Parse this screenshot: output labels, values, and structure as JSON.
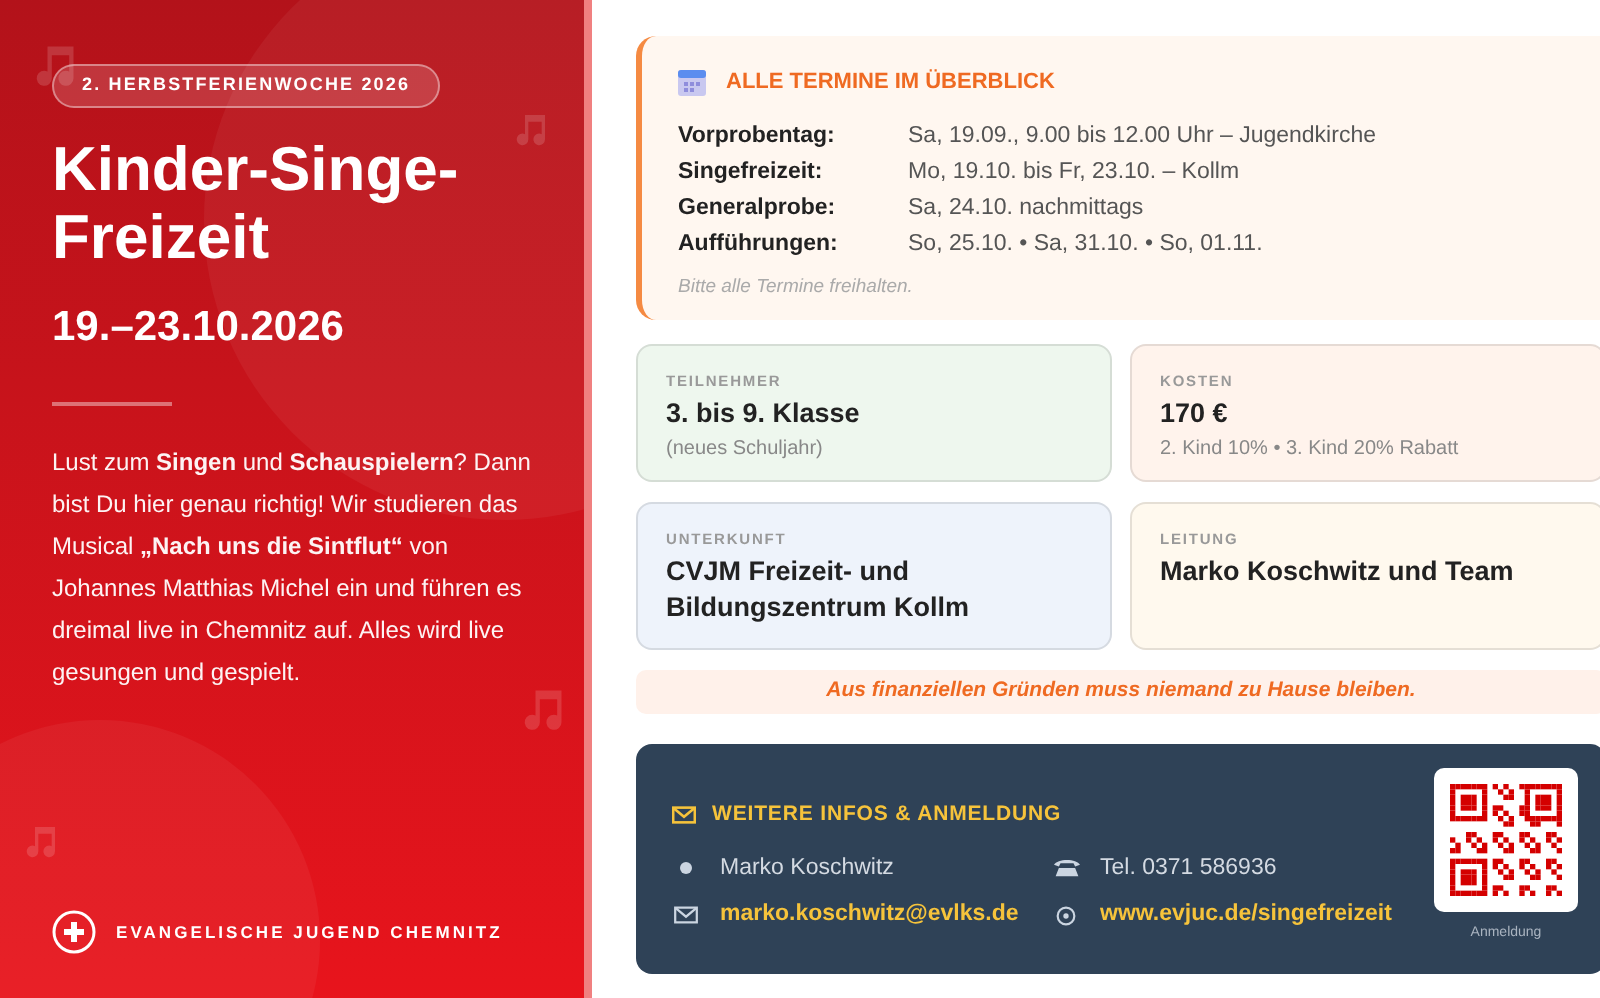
{
  "hero": {
    "badge": "2. HERBSTFERIENWOCHE 2026",
    "title": "Kinder-Singe-Freizeit",
    "date": "19.–23.10.2026",
    "intro": "Lust zum **Singen** und **Schauspielern**? Dann bist Du hier genau richtig! Wir studieren das Musical **„Nach uns die Sintflut“** von Johannes Matthias Michel ein und führen es dreimal live in Chemnitz auf. Alles wird live gesungen und gespielt.",
    "organization": "EVANGELISCHE JUGEND CHEMNITZ"
  },
  "schedule": {
    "title": "ALLE TERMINE IM ÜBERBLICK",
    "rows": [
      {
        "label": "Vorprobentag:",
        "value": "Sa, 19.09., 9.00 bis 12.00 Uhr – Jugendkirche"
      },
      {
        "label": "Singefreizeit:",
        "value": "Mo, 19.10. bis Fr, 23.10. – Kollm"
      },
      {
        "label": "Generalprobe:",
        "value": "Sa, 24.10. nachmittags"
      },
      {
        "label": "Aufführungen:",
        "value": "So, 25.10. • Sa, 31.10. • So, 01.11."
      }
    ],
    "note": "Bitte alle Termine freihalten."
  },
  "info_cards": [
    {
      "label": "TEILNEHMER",
      "value": "3. bis 9. Klasse",
      "detail": "(neues Schuljahr)",
      "color": "#eef7ee"
    },
    {
      "label": "KOSTEN",
      "value": "170 €",
      "detail": "2. Kind 10% • 3. Kind 20% Rabatt",
      "color": "#fff3ec"
    },
    {
      "label": "UNTERKUNFT",
      "value": "CVJM Freizeit- und Bildungszentrum Kollm",
      "color": "#eef3fb"
    },
    {
      "label": "LEITUNG",
      "value": "Marko Koschwitz und Team",
      "color": "#fff9ee"
    }
  ],
  "notice": "Aus finanziellen Gründen muss niemand zu Hause bleiben.",
  "contact": {
    "title": "WEITERE INFOS & ANMELDUNG",
    "items": [
      {
        "kind": "person",
        "text": "Marko Koschwitz"
      },
      {
        "kind": "phone",
        "text": "Tel. 0371 586936"
      },
      {
        "kind": "email",
        "text": "marko.koschwitz@evlks.de"
      },
      {
        "kind": "web",
        "text": "www.evjuc.de/singefreizeit"
      }
    ],
    "qr_caption": "Anmeldung"
  }
}
